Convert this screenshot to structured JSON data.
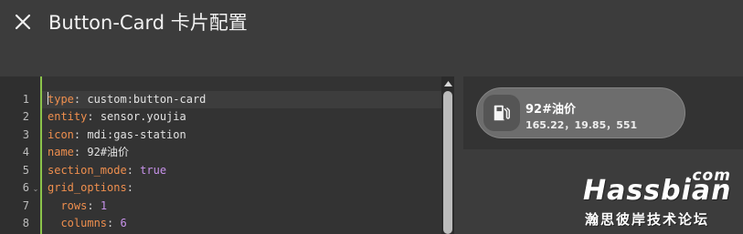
{
  "header": {
    "title": "Button-Card 卡片配置",
    "close_icon": "close-icon"
  },
  "editor": {
    "lines": [
      {
        "num": "1",
        "fold": "",
        "key": "type",
        "sep": ": ",
        "value": "custom:button-card",
        "value_type": "string"
      },
      {
        "num": "2",
        "fold": "",
        "key": "entity",
        "sep": ": ",
        "value": "sensor.youjia",
        "value_type": "string"
      },
      {
        "num": "3",
        "fold": "",
        "key": "icon",
        "sep": ": ",
        "value": "mdi:gas-station",
        "value_type": "string"
      },
      {
        "num": "4",
        "fold": "",
        "key": "name",
        "sep": ": ",
        "value": "92#油价",
        "value_type": "string"
      },
      {
        "num": "5",
        "fold": "",
        "key": "section_mode",
        "sep": ": ",
        "value": "true",
        "value_type": "bool"
      },
      {
        "num": "6",
        "fold": "⌄",
        "key": "grid_options",
        "sep": ":",
        "value": "",
        "value_type": "string"
      },
      {
        "num": "7",
        "fold": "",
        "key": "  rows",
        "sep": ": ",
        "value": "1",
        "value_type": "number"
      },
      {
        "num": "8",
        "fold": "",
        "key": "  columns",
        "sep": ": ",
        "value": "6",
        "value_type": "number"
      }
    ],
    "accent_color": "#8bc34a"
  },
  "preview_card": {
    "icon": "gas-station-icon",
    "name": "92#油价",
    "state": "165.22，19.85，551"
  },
  "watermark": {
    "com": ".com",
    "name": "Hassbian",
    "subtitle": "瀚思彼岸技术论坛"
  }
}
